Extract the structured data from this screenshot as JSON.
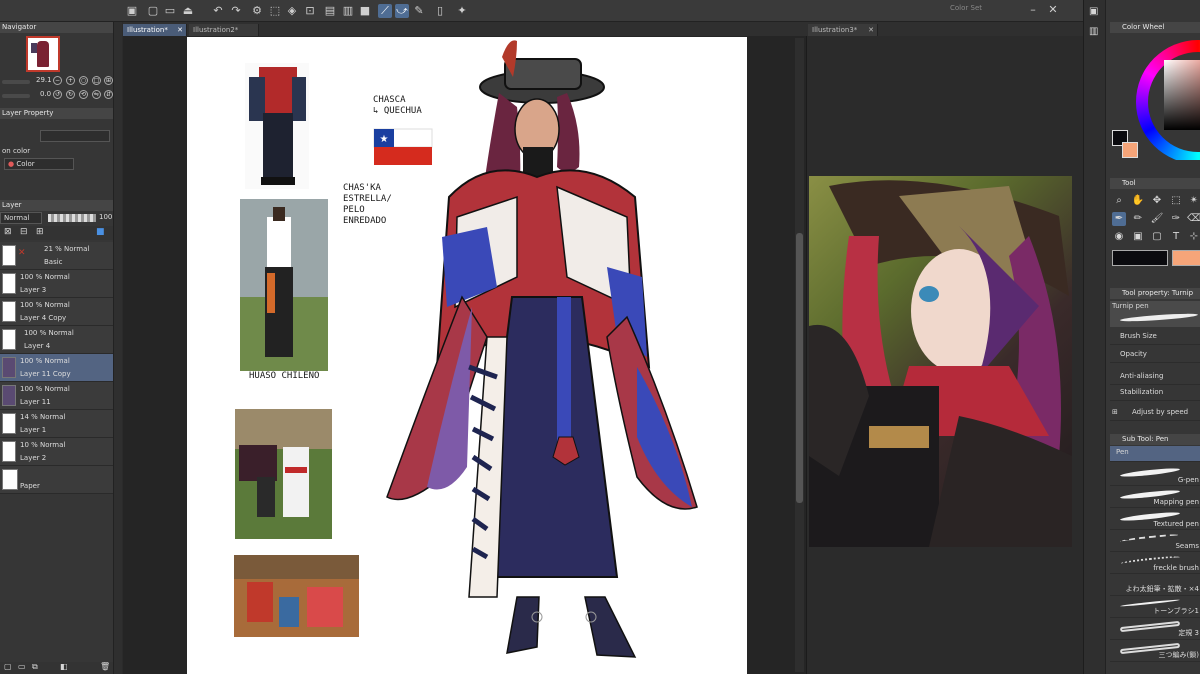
{
  "toolbar": {
    "icons": [
      "menu-icon",
      "new-icon",
      "open-icon",
      "save-icon",
      "export-icon",
      "undo-icon",
      "redo-icon",
      "clear-icon",
      "transform-icon",
      "fill-icon",
      "crop-icon",
      "rule-icon",
      "snap-icon",
      "snap-curve-icon",
      "pen-icon",
      "text-icon",
      "layer-icon",
      "info-icon"
    ]
  },
  "tabs": {
    "t1": "Illustration*",
    "t2": "Illustration2*",
    "t3": "Illustration3*"
  },
  "window_title": "Color Set",
  "navigator": {
    "title": "Navigator",
    "zoom": "29.1",
    "rotate": "0.0"
  },
  "layer_property": {
    "title": "Layer Property",
    "expression_label": "on color",
    "color_mode": "Color"
  },
  "layer_panel": {
    "title": "Layer",
    "blend": "Normal",
    "opacity": "100",
    "layers": [
      {
        "pct": "21 % Normal",
        "name": "Basic"
      },
      {
        "pct": "100 % Normal",
        "name": "Layer 3"
      },
      {
        "pct": "100 % Normal",
        "name": "Layer 4 Copy"
      },
      {
        "pct": "100 % Normal",
        "name": "Layer 4"
      },
      {
        "pct": "100 % Normal",
        "name": "Layer 11 Copy"
      },
      {
        "pct": "100 % Normal",
        "name": "Layer 11"
      },
      {
        "pct": "14 % Normal",
        "name": "Layer 1"
      },
      {
        "pct": "10 % Normal",
        "name": "Layer 2"
      },
      {
        "pct": "",
        "name": "Paper"
      }
    ]
  },
  "canvas_notes": {
    "chasca": "CHASCA\n↳ QUECHUA",
    "estrella": "CHAS'KA\nESTRELLA/\nPELO\nENREDADO",
    "huaso": "HUASO CHILENO"
  },
  "right_panel": {
    "color_wheel": "Color Wheel",
    "tool": "Tool",
    "tool_property": "Tool property: Turnip",
    "brush_preview": "Turnip pen",
    "properties": [
      "Brush Size",
      "Opacity",
      "Anti-aliasing",
      "Stabilization",
      "Adjust by speed"
    ],
    "sub_tool": "Sub Tool: Pen",
    "brushes": [
      "Pen",
      "G-pen",
      "Mapping pen",
      "Textured pen",
      "Seams",
      "freckle brush",
      "よわ太鉛筆・拡散・×4",
      "トーンブラシ1",
      "定規 3",
      "三つ編み(鎖)"
    ],
    "main_color": "#0b0b0f",
    "sub_color": "#f6a579"
  }
}
